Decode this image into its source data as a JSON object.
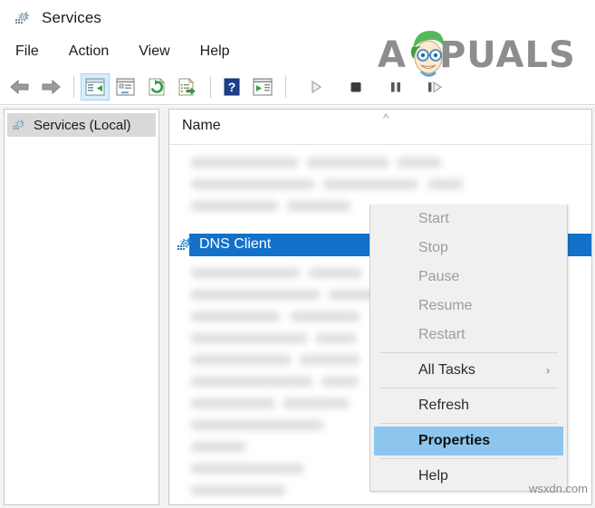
{
  "window": {
    "title": "Services",
    "title_icon": "services-gear-icon"
  },
  "menubar": {
    "items": [
      {
        "label": "File"
      },
      {
        "label": "Action"
      },
      {
        "label": "View"
      },
      {
        "label": "Help"
      }
    ]
  },
  "toolbar": {
    "buttons": [
      {
        "name": "back-icon",
        "tooltip": "Back"
      },
      {
        "name": "forward-icon",
        "tooltip": "Forward"
      },
      {
        "name": "show-console-tree-icon",
        "tooltip": "Show/Hide Console Tree",
        "active": true
      },
      {
        "name": "properties-window-icon",
        "tooltip": "Properties"
      },
      {
        "name": "refresh-icon",
        "tooltip": "Refresh"
      },
      {
        "name": "export-list-icon",
        "tooltip": "Export List"
      },
      {
        "name": "help-icon",
        "tooltip": "Help"
      },
      {
        "name": "show-action-pane-icon",
        "tooltip": "Show/Hide Action Pane"
      },
      {
        "name": "start-service-icon",
        "tooltip": "Start Service"
      },
      {
        "name": "stop-service-icon",
        "tooltip": "Stop Service"
      },
      {
        "name": "pause-service-icon",
        "tooltip": "Pause Service"
      },
      {
        "name": "restart-service-icon",
        "tooltip": "Restart Service"
      }
    ]
  },
  "sidebar": {
    "node_label": "Services (Local)",
    "node_icon": "services-gear-icon"
  },
  "list": {
    "column_header": "Name",
    "sort_indicator": "^",
    "selected_row": {
      "label": "DNS Client",
      "icon": "services-gear-icon"
    }
  },
  "context_menu": {
    "items": [
      {
        "label": "Start",
        "disabled": true,
        "submenu": false,
        "highlighted": false
      },
      {
        "label": "Stop",
        "disabled": true,
        "submenu": false,
        "highlighted": false
      },
      {
        "label": "Pause",
        "disabled": true,
        "submenu": false,
        "highlighted": false
      },
      {
        "label": "Resume",
        "disabled": true,
        "submenu": false,
        "highlighted": false
      },
      {
        "label": "Restart",
        "disabled": true,
        "submenu": false,
        "highlighted": false
      },
      {
        "label": "All Tasks",
        "disabled": false,
        "submenu": true,
        "highlighted": false,
        "submenu_arrow": "›"
      },
      {
        "label": "Refresh",
        "disabled": false,
        "submenu": false,
        "highlighted": false
      },
      {
        "label": "Properties",
        "disabled": false,
        "submenu": false,
        "highlighted": true
      },
      {
        "label": "Help",
        "disabled": false,
        "submenu": false,
        "highlighted": false
      }
    ]
  },
  "watermarks": {
    "brand": "PUALS",
    "brand_prefix": "A",
    "site": "wsxdn.com"
  },
  "colors": {
    "selection_blue": "#1371ca",
    "menu_highlight": "#8cc6ee",
    "toolbar_active": "#d8eefb",
    "window_bg": "#ffffff",
    "pane_bg": "#f3f3f3"
  }
}
